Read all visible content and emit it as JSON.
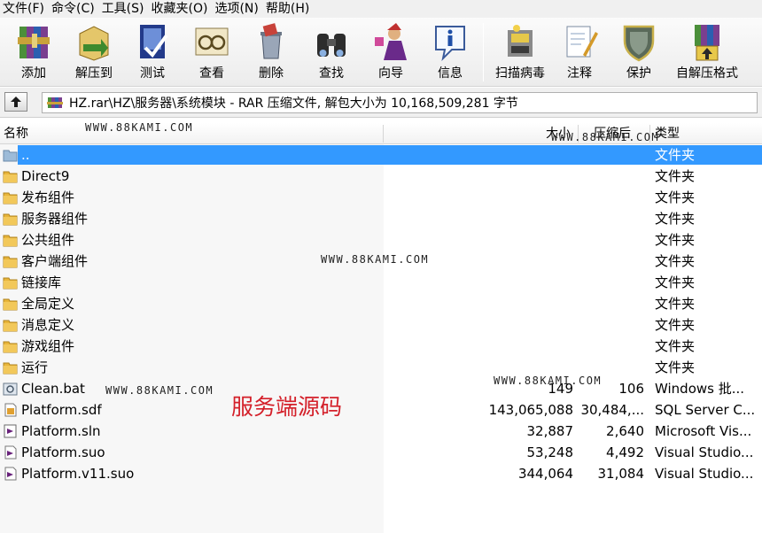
{
  "menu": [
    {
      "label": "文件(F)"
    },
    {
      "label": "命令(C)"
    },
    {
      "label": "工具(S)"
    },
    {
      "label": "收藏夹(O)"
    },
    {
      "label": "选项(N)"
    },
    {
      "label": "帮助(H)"
    }
  ],
  "toolbar": [
    {
      "label": "添加",
      "icon": "add-archive-icon"
    },
    {
      "label": "解压到",
      "icon": "extract-to-icon"
    },
    {
      "label": "测试",
      "icon": "test-icon"
    },
    {
      "label": "查看",
      "icon": "view-icon"
    },
    {
      "label": "删除",
      "icon": "delete-icon"
    },
    {
      "label": "查找",
      "icon": "find-icon"
    },
    {
      "label": "向导",
      "icon": "wizard-icon"
    },
    {
      "label": "信息",
      "icon": "info-icon"
    },
    {
      "label": "扫描病毒",
      "icon": "virus-scan-icon"
    },
    {
      "label": "注释",
      "icon": "comment-icon"
    },
    {
      "label": "保护",
      "icon": "protect-icon"
    },
    {
      "label": "自解压格式",
      "icon": "sfx-icon"
    }
  ],
  "address": {
    "path": "HZ.rar\\HZ\\服务器\\系统模块 - RAR 压缩文件, 解包大小为 10,168,509,281 字节"
  },
  "columns": {
    "name": "名称",
    "size": "大小",
    "packed": "压缩后",
    "type": "类型"
  },
  "rows": [
    {
      "name": "..",
      "size": "",
      "packed": "",
      "type": "文件夹",
      "icon": "parent-folder-icon"
    },
    {
      "name": "Direct9",
      "size": "",
      "packed": "",
      "type": "文件夹",
      "icon": "folder-icon"
    },
    {
      "name": "发布组件",
      "size": "",
      "packed": "",
      "type": "文件夹",
      "icon": "folder-icon"
    },
    {
      "name": "服务器组件",
      "size": "",
      "packed": "",
      "type": "文件夹",
      "icon": "folder-icon"
    },
    {
      "name": "公共组件",
      "size": "",
      "packed": "",
      "type": "文件夹",
      "icon": "folder-icon"
    },
    {
      "name": "客户端组件",
      "size": "",
      "packed": "",
      "type": "文件夹",
      "icon": "folder-icon"
    },
    {
      "name": "链接库",
      "size": "",
      "packed": "",
      "type": "文件夹",
      "icon": "folder-icon"
    },
    {
      "name": "全局定义",
      "size": "",
      "packed": "",
      "type": "文件夹",
      "icon": "folder-icon"
    },
    {
      "name": "消息定义",
      "size": "",
      "packed": "",
      "type": "文件夹",
      "icon": "folder-icon"
    },
    {
      "name": "游戏组件",
      "size": "",
      "packed": "",
      "type": "文件夹",
      "icon": "folder-icon"
    },
    {
      "name": "运行",
      "size": "",
      "packed": "",
      "type": "文件夹",
      "icon": "folder-icon"
    },
    {
      "name": "Clean.bat",
      "size": "149",
      "packed": "106",
      "type": "Windows 批...",
      "icon": "batch-file-icon"
    },
    {
      "name": "Platform.sdf",
      "size": "143,065,088",
      "packed": "30,484,...",
      "type": "SQL Server C...",
      "icon": "sdf-file-icon"
    },
    {
      "name": "Platform.sln",
      "size": "32,887",
      "packed": "2,640",
      "type": "Microsoft Vis...",
      "icon": "sln-file-icon"
    },
    {
      "name": "Platform.suo",
      "size": "53,248",
      "packed": "4,492",
      "type": "Visual Studio...",
      "icon": "suo-file-icon"
    },
    {
      "name": "Platform.v11.suo",
      "size": "344,064",
      "packed": "31,084",
      "type": "Visual Studio...",
      "icon": "suo-file-icon"
    }
  ],
  "watermark": "WWW.88KAMI.COM",
  "note": "服务端源码",
  "colors": {
    "selection": "#3399ff",
    "folder": "#e8b53a",
    "note": "#d4202a"
  }
}
